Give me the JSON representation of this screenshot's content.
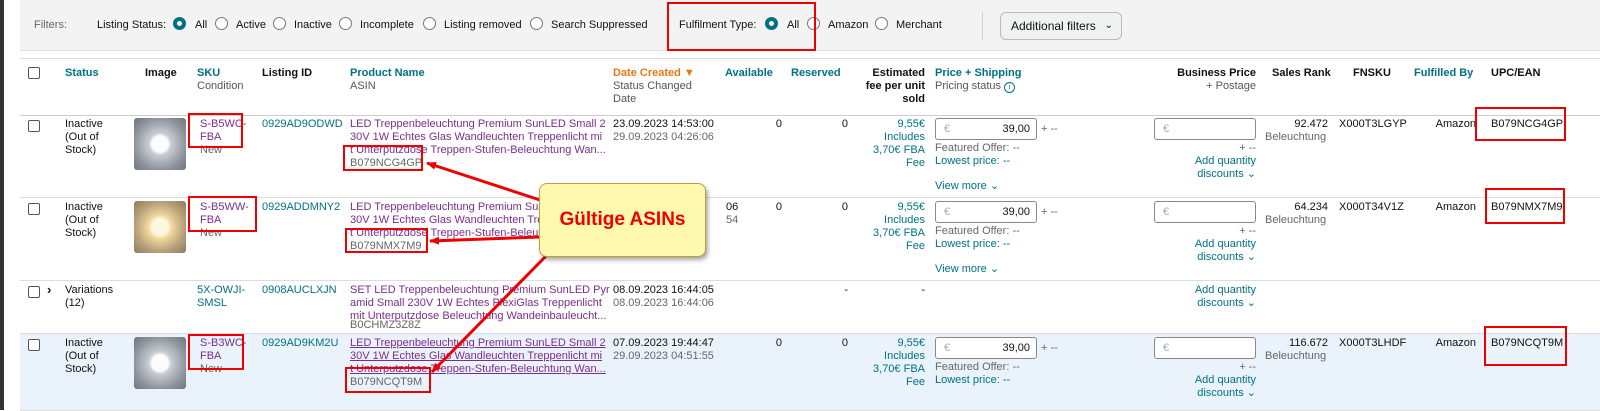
{
  "filters": {
    "label": "Filters:",
    "listing_status_label": "Listing Status:",
    "listing_status_options": [
      "All",
      "Active",
      "Inactive",
      "Incomplete",
      "Listing removed",
      "Search Suppressed"
    ],
    "fulfilment_label": "Fulfilment Type:",
    "fulfilment_options": [
      "All",
      "Amazon",
      "Merchant"
    ],
    "additional_filters": "Additional filters"
  },
  "columns": {
    "status": "Status",
    "image": "Image",
    "sku": "SKU",
    "sku_sub": "Condition",
    "listing_id": "Listing ID",
    "product_name": "Product Name",
    "product_sub": "ASIN",
    "date_created": "Date Created",
    "date_sub1": "Status Changed",
    "date_sub2": "Date",
    "available": "Available",
    "reserved": "Reserved",
    "fee1": "Estimated",
    "fee2": "fee per unit",
    "fee3": "sold",
    "price": "Price + Shipping",
    "price_sub": "Pricing status",
    "business_price": "Business Price",
    "business_sub": "+ Postage",
    "sales_rank": "Sales Rank",
    "fnsku": "FNSKU",
    "fulfilled_by": "Fulfilled By",
    "upc": "UPC/EAN"
  },
  "rows": [
    {
      "status": [
        "Inactive",
        "(Out of",
        "Stock)"
      ],
      "sku": [
        "S-B5WC-",
        "FBA"
      ],
      "condition": "New",
      "listing_id": "0929AD9ODWD",
      "name": [
        "LED Treppenbeleuchtung Premium SunLED Small 2",
        "30V 1W Echtes Glas Wandleuchten Treppenlicht mi",
        "t Unterputzdose Treppen-Stufen-Beleuchtung Wan..."
      ],
      "asin": "B079NCG4GP",
      "created": "23.09.2023 14:53:00",
      "changed": "29.09.2023 04:26:06",
      "available": "0",
      "reserved": "0",
      "fee": [
        "9,55€",
        "Includes",
        "3,70€ FBA",
        "Fee"
      ],
      "price": "39,00",
      "featured": "Featured Offer: --",
      "lowest": "Lowest price: --",
      "view_more": "View more",
      "rank": "92.472",
      "rank_cat": "Beleuchtung",
      "fnsku": "X000T3LGYP",
      "fulfilled": "Amazon",
      "upc": "B079NCG4GP"
    },
    {
      "status": [
        "Inactive",
        "(Out of",
        "Stock)"
      ],
      "sku": [
        "S-B5WW-",
        "FBA"
      ],
      "condition": "New",
      "listing_id": "0929ADDMNY2",
      "name": [
        "LED Treppenbeleuchtung Premium Sun",
        "30V 1W Echtes Glas Wandleuchten Tre",
        "t Unterputzdose Treppen-Stufen-Beleuchtung Wan..."
      ],
      "asin": "B079NMX7M9",
      "created": "06",
      "changed": "54",
      "available": "0",
      "reserved": "0",
      "fee": [
        "9,55€",
        "Includes",
        "3,70€ FBA",
        "Fee"
      ],
      "price": "39,00",
      "featured": "Featured Offer: --",
      "lowest": "Lowest price: --",
      "view_more": "View more",
      "rank": "64.234",
      "rank_cat": "Beleuchtung",
      "fnsku": "X000T34V1Z",
      "fulfilled": "Amazon",
      "upc": "B079NMX7M9"
    },
    {
      "status": [
        "Variations",
        "(12)"
      ],
      "sku": [
        "5X-OWJI-",
        "SMSL"
      ],
      "listing_id": "0908AUCLXJN",
      "name": [
        "SET LED Treppenbeleuchtung Premium SunLED Pyr",
        "amid Small 230V 1W Echtes PlexiGlas Treppenlicht",
        "mit Unterputzdose Beleuchtung Wandeinbauleucht..."
      ],
      "asin": "B0CHMZ3Z8Z",
      "created": "08.09.2023 16:44:05",
      "changed": "08.09.2023 16:44:06",
      "available": "-",
      "reserved": "-"
    },
    {
      "status": [
        "Inactive",
        "(Out of",
        "Stock)"
      ],
      "sku": [
        "S-B3WC-",
        "FBA"
      ],
      "condition": "New",
      "listing_id": "0929AD9KM2U",
      "name": [
        "LED Treppenbeleuchtung Premium SunLED Small 2",
        "30V 1W Echtes Glas Wandleuchten Treppenlicht mi",
        "t Unterputzdose Treppen-Stufen-Beleuchtung Wan..."
      ],
      "asin": "B079NCQT9M",
      "created": "07.09.2023 19:44:47",
      "changed": "29.09.2023 04:51:55",
      "available": "0",
      "reserved": "0",
      "fee": [
        "9,55€",
        "Includes",
        "3,70€ FBA",
        "Fee"
      ],
      "price": "39,00",
      "featured": "Featured Offer: --",
      "lowest": "Lowest price: --",
      "rank": "116.672",
      "rank_cat": "Beleuchtung",
      "fnsku": "X000T3LHDF",
      "fulfilled": "Amazon",
      "upc": "B079NCQT9M"
    }
  ],
  "shared": {
    "currency": "€",
    "plus_dash": "+ --",
    "add_qty": "Add quantity",
    "discounts": "discounts"
  },
  "callout": "Gültige ASINs",
  "colors": {
    "accent": "#007185",
    "highlight": "#e00000",
    "callout_bg": "#fff9b0"
  }
}
